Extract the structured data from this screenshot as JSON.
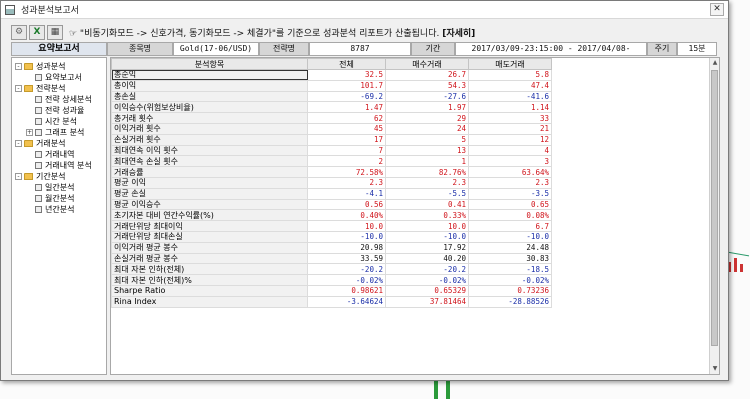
{
  "window": {
    "title": "성과분석보고서",
    "close_label": "✕"
  },
  "toolbar": {
    "info_prefix": "☞ \"비동기화모드 -> 신호가격, 동기화모드 -> 체결가\"를 기준으로 성과분석 리포트가 산출됩니다.",
    "info_link": "[자세히]",
    "excel_icon": "excel-icon",
    "calendar_icon": "calendar-icon",
    "settings_icon": "gear-icon"
  },
  "summary": {
    "report_label": "요약보고서",
    "item_label": "종목명",
    "item_value": "Gold(17-06/USD)",
    "strategy_label": "전략명",
    "strategy_value": "8787",
    "period_label": "기간",
    "period_value": "2017/03/09-23:15:00 - 2017/04/08-06:00:00",
    "cycle_label": "주기",
    "cycle_value": "15분"
  },
  "tree": [
    {
      "level": 0,
      "label": "성과분석",
      "type": "folder",
      "expand": "-"
    },
    {
      "level": 1,
      "label": "요약보고서",
      "type": "doc"
    },
    {
      "level": 0,
      "label": "전략분석",
      "type": "folder",
      "expand": "-"
    },
    {
      "level": 1,
      "label": "전략 상세분석",
      "type": "doc"
    },
    {
      "level": 1,
      "label": "전략 성과율",
      "type": "doc"
    },
    {
      "level": 1,
      "label": "시간 분석",
      "type": "doc"
    },
    {
      "level": 1,
      "label": "그래프 분석",
      "type": "doc",
      "expand": "+"
    },
    {
      "level": 0,
      "label": "거래분석",
      "type": "folder",
      "expand": "-"
    },
    {
      "level": 1,
      "label": "거래내역",
      "type": "doc"
    },
    {
      "level": 1,
      "label": "거래내역 분석",
      "type": "doc"
    },
    {
      "level": 0,
      "label": "기간분석",
      "type": "folder",
      "expand": "-"
    },
    {
      "level": 1,
      "label": "일간분석",
      "type": "doc"
    },
    {
      "level": 1,
      "label": "월간분석",
      "type": "doc"
    },
    {
      "level": 1,
      "label": "년간분석",
      "type": "doc"
    }
  ],
  "table": {
    "headers": [
      "분석항목",
      "전체",
      "매수거래",
      "매도거래"
    ],
    "rows": [
      {
        "name": "총순익",
        "total": "32.5",
        "buy": "26.7",
        "sell": "5.8",
        "colors": [
          "red",
          "red",
          "red"
        ]
      },
      {
        "name": "총이익",
        "total": "101.7",
        "buy": "54.3",
        "sell": "47.4",
        "colors": [
          "red",
          "red",
          "red"
        ]
      },
      {
        "name": "총손실",
        "total": "-69.2",
        "buy": "-27.6",
        "sell": "-41.6",
        "colors": [
          "blue",
          "blue",
          "blue"
        ]
      },
      {
        "name": "이익승수(위험보상비율)",
        "total": "1.47",
        "buy": "1.97",
        "sell": "1.14",
        "colors": [
          "red",
          "red",
          "red"
        ]
      },
      {
        "name": "총거래 횟수",
        "total": "62",
        "buy": "29",
        "sell": "33",
        "colors": [
          "red",
          "red",
          "red"
        ]
      },
      {
        "name": "이익거래 횟수",
        "total": "45",
        "buy": "24",
        "sell": "21",
        "colors": [
          "red",
          "red",
          "red"
        ]
      },
      {
        "name": "손실거래 횟수",
        "total": "17",
        "buy": "5",
        "sell": "12",
        "colors": [
          "red",
          "red",
          "red"
        ]
      },
      {
        "name": "최대연속 이익 횟수",
        "total": "7",
        "buy": "13",
        "sell": "4",
        "colors": [
          "red",
          "red",
          "red"
        ]
      },
      {
        "name": "최대연속 손실 횟수",
        "total": "2",
        "buy": "1",
        "sell": "3",
        "colors": [
          "red",
          "red",
          "red"
        ]
      },
      {
        "name": "거래승률",
        "total": "72.58%",
        "buy": "82.76%",
        "sell": "63.64%",
        "colors": [
          "red",
          "red",
          "red"
        ]
      },
      {
        "name": "평균 이익",
        "total": "2.3",
        "buy": "2.3",
        "sell": "2.3",
        "colors": [
          "red",
          "red",
          "red"
        ]
      },
      {
        "name": "평균 손실",
        "total": "-4.1",
        "buy": "-5.5",
        "sell": "-3.5",
        "colors": [
          "blue",
          "blue",
          "blue"
        ]
      },
      {
        "name": "평균 이익승수",
        "total": "0.56",
        "buy": "0.41",
        "sell": "0.65",
        "colors": [
          "red",
          "red",
          "red"
        ]
      },
      {
        "name": "초기자본 대비 연간수익률(%)",
        "total": "0.40%",
        "buy": "0.33%",
        "sell": "0.08%",
        "colors": [
          "red",
          "red",
          "red"
        ]
      },
      {
        "name": "거래단위당 최대이익",
        "total": "10.0",
        "buy": "10.0",
        "sell": "6.7",
        "colors": [
          "red",
          "red",
          "red"
        ]
      },
      {
        "name": "거래단위당 최대손실",
        "total": "-10.0",
        "buy": "-10.0",
        "sell": "-10.0",
        "colors": [
          "blue",
          "blue",
          "blue"
        ]
      },
      {
        "name": "이익거래 평균 봉수",
        "total": "20.98",
        "buy": "17.92",
        "sell": "24.48",
        "colors": [
          "black",
          "black",
          "black"
        ]
      },
      {
        "name": "손실거래 평균 봉수",
        "total": "33.59",
        "buy": "40.20",
        "sell": "30.83",
        "colors": [
          "black",
          "black",
          "black"
        ]
      },
      {
        "name": "최대 자본 인하(전체)",
        "total": "-20.2",
        "buy": "-20.2",
        "sell": "-18.5",
        "colors": [
          "blue",
          "blue",
          "blue"
        ]
      },
      {
        "name": "최대 자본 인하(전체)%",
        "total": "-0.02%",
        "buy": "-0.02%",
        "sell": "-0.02%",
        "colors": [
          "blue",
          "blue",
          "blue"
        ]
      },
      {
        "name": "Sharpe Ratio",
        "total": "0.98621",
        "buy": "0.65329",
        "sell": "0.73236",
        "colors": [
          "red",
          "red",
          "red"
        ]
      },
      {
        "name": "Rina Index",
        "total": "-3.64624",
        "buy": "37.81464",
        "sell": "-28.88526",
        "colors": [
          "blue",
          "red",
          "blue"
        ]
      }
    ]
  }
}
